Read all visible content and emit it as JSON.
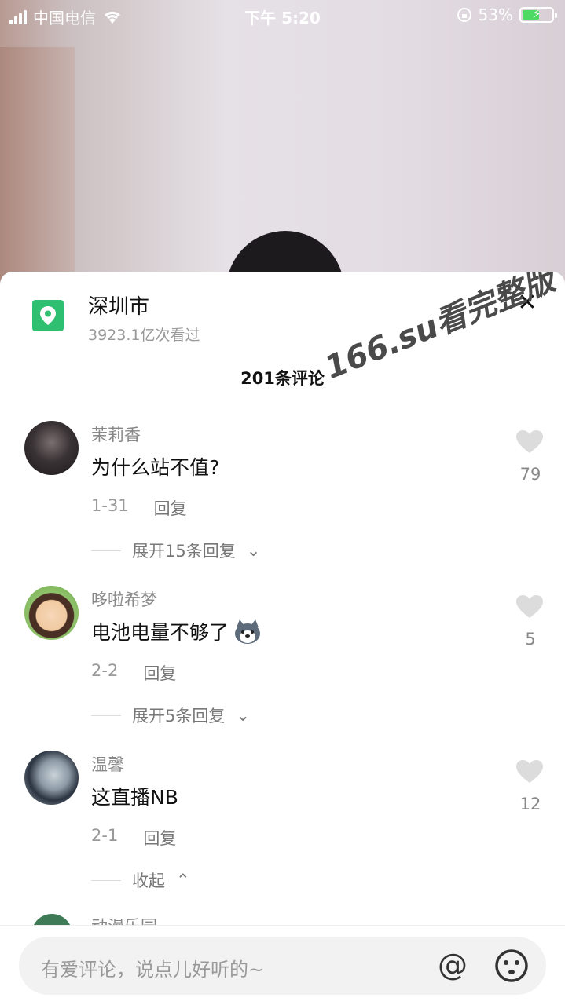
{
  "status_bar": {
    "carrier": "中国电信",
    "time": "下午 5:20",
    "battery_percent": "53%"
  },
  "location": {
    "title": "深圳市",
    "views": "3923.1亿次看过"
  },
  "watermark": "166.su看完整版",
  "comments_count": "201条评论",
  "comments": [
    {
      "user": "茉莉香",
      "text": "为什么站不值?",
      "date": "1-31",
      "reply": "回复",
      "likes": "79",
      "expand": "展开15条回复"
    },
    {
      "user": "哆啦希梦",
      "text": "电池电量不够了",
      "date": "2-2",
      "reply": "回复",
      "likes": "5",
      "expand": "展开5条回复"
    },
    {
      "user": "温馨",
      "text": "这直播NB",
      "date": "2-1",
      "reply": "回复",
      "likes": "12",
      "expand": "收起"
    }
  ],
  "peek_user": "动漫乐园",
  "input": {
    "placeholder": "有爱评论，说点儿好听的~",
    "at_symbol": "@"
  },
  "colors": {
    "accent_green": "#2fbf71",
    "battery_green": "#4cd964"
  }
}
